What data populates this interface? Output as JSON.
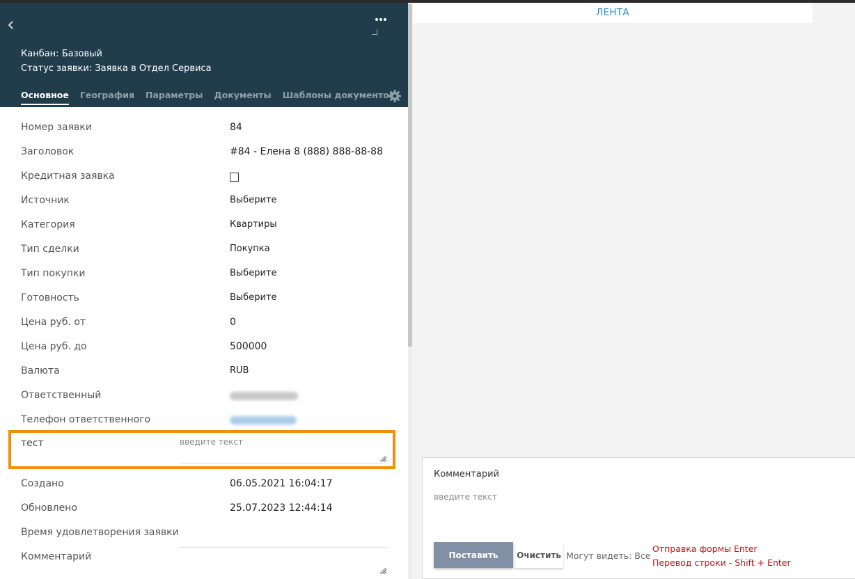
{
  "header": {
    "back_icon": "chevron-left-icon",
    "more_icon": "ellipsis-icon",
    "kanban_line": "Канбан: Базовый",
    "status_line": "Статус заявки: Заявка в Отдел Сервиса",
    "tabs": [
      {
        "label": "Основное",
        "active": true
      },
      {
        "label": "География",
        "active": false
      },
      {
        "label": "Параметры",
        "active": false
      },
      {
        "label": "Документы",
        "active": false
      },
      {
        "label": "Шаблоны документов",
        "active": false
      }
    ],
    "settings_icon": "gear-icon",
    "background_color": "#213d4b"
  },
  "fields": [
    {
      "label": "Номер заявки",
      "value": "84"
    },
    {
      "label": "Заголовок",
      "value": "#84 - Елена 8 (888) 888-88-88"
    },
    {
      "label": "Кредитная заявка",
      "checked": false
    },
    {
      "label": "Источник",
      "value": "Выберите"
    },
    {
      "label": "Категория",
      "value": "Квартиры"
    },
    {
      "label": "Тип сделки",
      "value": "Покупка"
    },
    {
      "label": "Тип покупки",
      "value": "Выберите"
    },
    {
      "label": "Готовность",
      "value": "Выберите"
    },
    {
      "label": "Цена руб. от",
      "value": "0"
    },
    {
      "label": "Цена руб. до",
      "value": "500000"
    },
    {
      "label": "Валюта",
      "value": "RUB"
    },
    {
      "label": "Ответственный"
    },
    {
      "label": "Телефон ответственного"
    }
  ],
  "test_field": {
    "label": "тест",
    "placeholder": "введите текст",
    "highlight_color": "#f0900a"
  },
  "meta_fields": [
    {
      "label": "Создано",
      "value": "06.05.2021 16:04:17"
    },
    {
      "label": "Обновлено",
      "value": "25.07.2023 12:44:14"
    },
    {
      "label": "Время удовлетворения заявки",
      "value": ""
    },
    {
      "label": "Комментарий",
      "value": ""
    }
  ],
  "feed": {
    "title": "ЛЕНТА",
    "title_color": "#2f8fc7"
  },
  "comment": {
    "title": "Комментарий",
    "placeholder": "введите текст",
    "post_label": "Поставить",
    "clear_label": "Очистить",
    "visibility": "Могут видеть: Все",
    "hint_send": "Отправка формы Enter",
    "hint_newline": "Перевод строки - Shift + Enter",
    "hint_color": "#c0111e",
    "post_button_color": "#8190a5"
  }
}
